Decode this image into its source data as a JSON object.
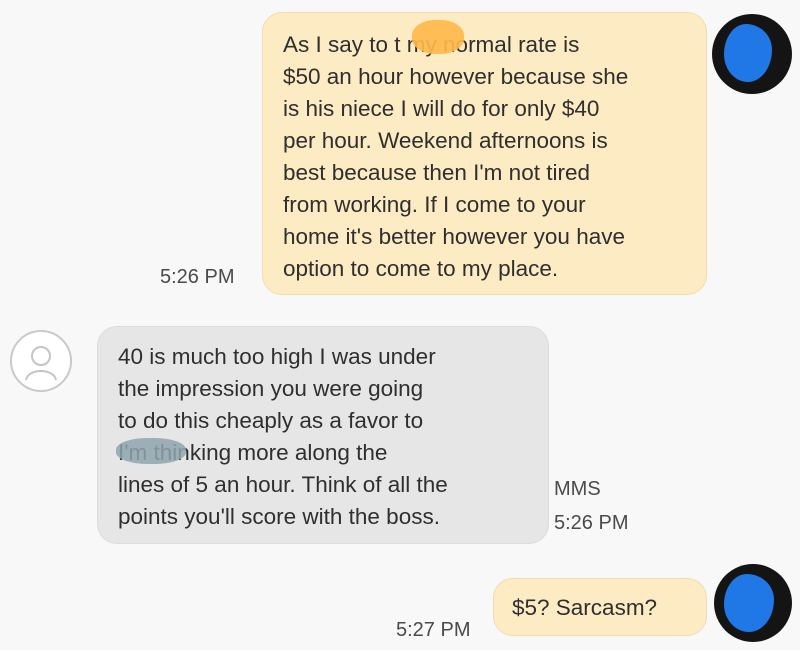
{
  "conversation": {
    "messages": [
      {
        "direction": "outgoing",
        "lines": [
          "As I say to t        my normal rate is",
          "$50 an hour however because she",
          "is his niece I will do for only $40",
          "per hour. Weekend afternoons is",
          "best because then I'm not tired",
          "from working.  If I come to your",
          "home it's better however you have",
          "option to come to my place."
        ],
        "time": "5:26 PM"
      },
      {
        "direction": "incoming",
        "lines": [
          "40 is much too high I was under",
          "the impression you were going",
          "to do this cheaply as a favor to",
          "           I'm thinking more along the",
          "lines of 5 an hour. Think of all the",
          "points you'll score with the boss."
        ],
        "type_label": "MMS",
        "time": "5:26 PM"
      },
      {
        "direction": "outgoing",
        "lines": [
          "$5? Sarcasm?"
        ],
        "time": "5:27 PM"
      }
    ]
  },
  "colors": {
    "outgoing_bubble": "#fdebc3",
    "incoming_bubble": "#e6e6e6",
    "user_avatar_blob": "#1f78e6",
    "redaction_orange": "#ffb84d",
    "redaction_gray": "#8ea3ad"
  },
  "icons": {
    "contact_avatar": "person-outline-icon",
    "user_avatar": "user-avatar-icon"
  }
}
